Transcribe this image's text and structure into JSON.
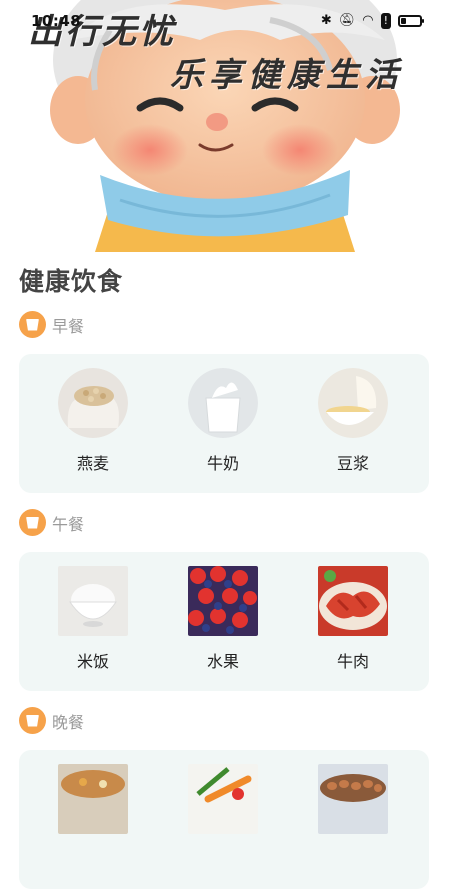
{
  "status_bar": {
    "time": "10:48",
    "icons": [
      "bluetooth-icon",
      "bell-off-icon",
      "wifi-icon",
      "alert-icon",
      "battery-icon"
    ],
    "battery_level": 0.25
  },
  "hero": {
    "title_line1": "出行无忧",
    "title_line2": "乐享健康生活",
    "image": "cartoon-grandpa-illustration",
    "colors": {
      "skin": "#f8c9a4",
      "scarf": "#8fcbe8",
      "hair": "#e9e9e9",
      "sweater": "#f5b94c"
    }
  },
  "section": {
    "title": "健康饮食"
  },
  "meals": [
    {
      "name": "早餐",
      "foods": [
        {
          "label": "燕麦",
          "image": "oats-image"
        },
        {
          "label": "牛奶",
          "image": "milk-image"
        },
        {
          "label": "豆浆",
          "image": "soy-milk-image"
        }
      ]
    },
    {
      "name": "午餐",
      "foods": [
        {
          "label": "米饭",
          "image": "rice-image"
        },
        {
          "label": "水果",
          "image": "fruit-image"
        },
        {
          "label": "牛肉",
          "image": "beef-image"
        }
      ]
    },
    {
      "name": "晚餐",
      "foods": [
        {
          "label": "",
          "image": "soup-image"
        },
        {
          "label": "",
          "image": "vegetables-image"
        },
        {
          "label": "",
          "image": "eggs-image"
        }
      ]
    }
  ],
  "colors": {
    "accent": "#f6a24a",
    "card_bg": "#f1f7f6",
    "title": "#444444",
    "muted": "#9a9a9a"
  }
}
